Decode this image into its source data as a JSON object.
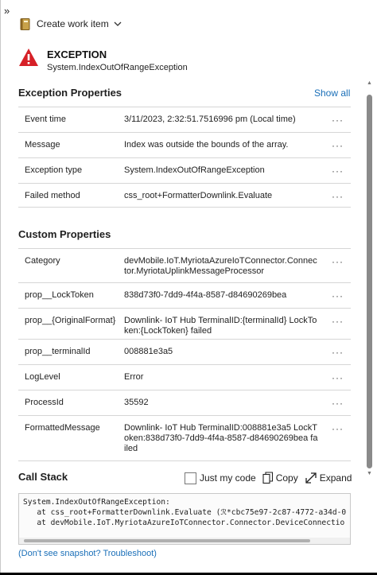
{
  "panel": {
    "collapse_glyph": "»"
  },
  "toolbar": {
    "create_label": "Create work item",
    "create_icon": "book-icon",
    "dropdown_icon": "chevron-down-icon"
  },
  "exception": {
    "title": "EXCEPTION",
    "type": "System.IndexOutOfRangeException",
    "icon": "warning-icon",
    "icon_color": "#d62027"
  },
  "exception_properties": {
    "title": "Exception Properties",
    "show_all": "Show all",
    "rows": [
      {
        "key": "Event time",
        "value": "3/11/2023, 2:32:51.7516996 pm (Local time)",
        "menu": "···"
      },
      {
        "key": "Message",
        "value": "Index was outside the bounds of the array.",
        "menu": "···"
      },
      {
        "key": "Exception type",
        "value": "System.IndexOutOfRangeException",
        "menu": "···"
      },
      {
        "key": "Failed method",
        "value": "css_root+FormatterDownlink.Evaluate",
        "menu": "···"
      }
    ]
  },
  "custom_properties": {
    "title": "Custom Properties",
    "rows": [
      {
        "key": "Category",
        "value": "devMobile.IoT.MyriotaAzureIoTConnector.Connector.MyriotaUplinkMessageProcessor",
        "menu": "···"
      },
      {
        "key": "prop__LockToken",
        "value": "838d73f0-7dd9-4f4a-8587-d84690269bea",
        "menu": "···"
      },
      {
        "key": "prop__{OriginalFormat}",
        "value": "Downlink- IoT Hub TerminalID:{terminalId} LockToken:{LockToken} failed",
        "menu": "···"
      },
      {
        "key": "prop__terminalId",
        "value": "008881e3a5",
        "menu": "···"
      },
      {
        "key": "LogLevel",
        "value": "Error",
        "menu": "···"
      },
      {
        "key": "ProcessId",
        "value": "35592",
        "menu": "···"
      },
      {
        "key": "FormattedMessage",
        "value": "Downlink- IoT Hub TerminalID:008881e3a5 LockToken:838d73f0-7dd9-4f4a-8587-d84690269bea failed",
        "menu": "···"
      }
    ]
  },
  "call_stack": {
    "title": "Call Stack",
    "just_my_code": "Just my code",
    "copy": "Copy",
    "expand": "Expand",
    "lines": [
      "System.IndexOutOfRangeException:",
      "   at css_root+FormatterDownlink.Evaluate (ℛ*cbc75e97-2c87-4772-a34d-0",
      "   at devMobile.IoT.MyriotaAzureIoTConnector.Connector.DeviceConnectio"
    ]
  },
  "footer": {
    "troubleshoot": "(Don't see snapshot? Troubleshoot)"
  },
  "colors": {
    "link": "#1a6fb8",
    "error": "#d62027"
  }
}
